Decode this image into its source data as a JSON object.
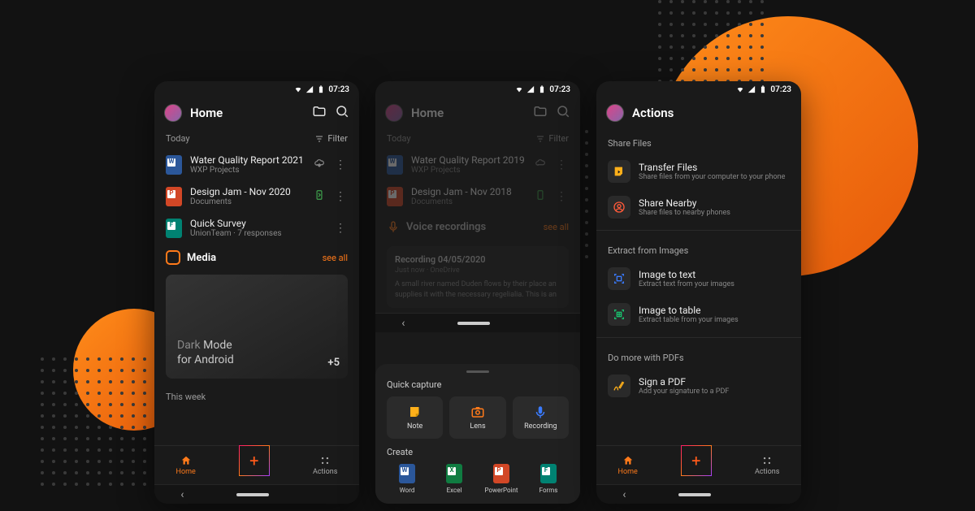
{
  "status_time": "07:23",
  "phone1": {
    "title": "Home",
    "today": "Today",
    "filter": "Filter",
    "files": [
      {
        "title": "Water Quality Report 2021",
        "sub": "WXP Projects"
      },
      {
        "title": "Design Jam - Nov 2020",
        "sub": "Documents"
      },
      {
        "title": "Quick Survey",
        "sub": "UnionTeam · 7 responses"
      }
    ],
    "media": "Media",
    "see_all": "see all",
    "card_l1a": "Dark ",
    "card_l1b": "Mode",
    "card_l2": "for Android",
    "card_count": "+5",
    "this_week": "This week",
    "nav_home": "Home",
    "nav_actions": "Actions"
  },
  "phone2": {
    "title": "Home",
    "today": "Today",
    "filter": "Filter",
    "files": [
      {
        "title": "Water Quality Report 2019",
        "sub": "WXP Projects"
      },
      {
        "title": "Design Jam - Nov 2018",
        "sub": "Documents"
      }
    ],
    "voice": "Voice recordings",
    "see_all": "see all",
    "rec_title": "Recording 04/05/2020",
    "rec_sub": "Just now · OneDrive",
    "rec_body": "A small river named Duden flows by their place an supplies it with the necessary regelialia. This is an",
    "quick_capture": "Quick capture",
    "qc": [
      "Note",
      "Lens",
      "Recording"
    ],
    "create": "Create",
    "apps": [
      "Word",
      "Excel",
      "PowerPoint",
      "Forms"
    ]
  },
  "phone3": {
    "title": "Actions",
    "s1": "Share Files",
    "a1t": "Transfer Files",
    "a1s": "Share files from your computer to your phone",
    "a2t": "Share Nearby",
    "a2s": "Share files to nearby phones",
    "s2": "Extract from Images",
    "a3t": "Image to text",
    "a3s": "Extract text from your images",
    "a4t": "Image to table",
    "a4s": "Extract table from your images",
    "s3": "Do more with PDFs",
    "a5t": "Sign a PDF",
    "a5s": "Add your signature to a PDF",
    "nav_home": "Home",
    "nav_actions": "Actions"
  }
}
